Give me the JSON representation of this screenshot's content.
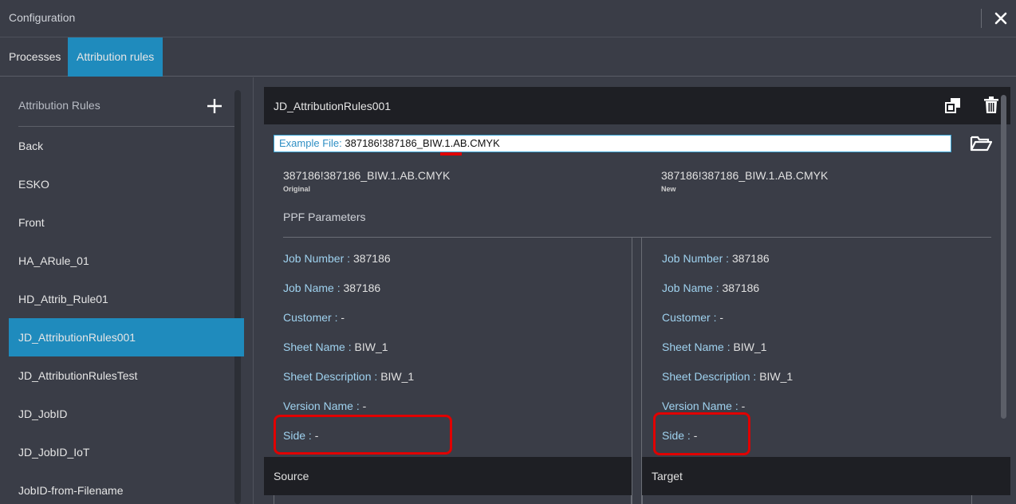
{
  "window": {
    "title": "Configuration",
    "close_icon": "close-icon"
  },
  "tabs": [
    {
      "label": "Processes",
      "active": false
    },
    {
      "label": "Attribution rules",
      "active": true
    }
  ],
  "sidebar": {
    "header": "Attribution Rules",
    "add_icon": "plus-icon",
    "items": [
      {
        "label": "Back",
        "active": false
      },
      {
        "label": "ESKO",
        "active": false
      },
      {
        "label": "Front",
        "active": false
      },
      {
        "label": "HA_ARule_01",
        "active": false
      },
      {
        "label": "HD_Attrib_Rule01",
        "active": false
      },
      {
        "label": "JD_AttributionRules001",
        "active": true
      },
      {
        "label": "JD_AttributionRulesTest",
        "active": false
      },
      {
        "label": "JD_JobID",
        "active": false
      },
      {
        "label": "JD_JobID_IoT",
        "active": false
      },
      {
        "label": "JobID-from-Filename",
        "active": false
      }
    ]
  },
  "rule": {
    "name": "JD_AttributionRules001",
    "example_label": "Example File:",
    "example_value": "387186!387186_BIW.1.AB.CMYK",
    "original_name": "387186!387186_BIW.1.AB.CMYK",
    "original_caption": "Original",
    "new_name": "387186!387186_BIW.1.AB.CMYK",
    "new_caption": "New",
    "section_title": "PPF Parameters",
    "source_params": [
      {
        "key": "Job Number",
        "value": "387186"
      },
      {
        "key": "Job Name",
        "value": "387186"
      },
      {
        "key": "Customer",
        "value": "-"
      },
      {
        "key": "Sheet Name",
        "value": "BIW_1"
      },
      {
        "key": "Sheet Description",
        "value": "BIW_1"
      },
      {
        "key": "Version Name",
        "value": "-"
      },
      {
        "key": "Side",
        "value": "-"
      }
    ],
    "target_params": [
      {
        "key": "Job Number",
        "value": "387186"
      },
      {
        "key": "Job Name",
        "value": "387186"
      },
      {
        "key": "Customer",
        "value": "-"
      },
      {
        "key": "Sheet Name",
        "value": "BIW_1"
      },
      {
        "key": "Sheet Description",
        "value": "BIW_1"
      },
      {
        "key": "Version Name",
        "value": "-"
      },
      {
        "key": "Side",
        "value": "-"
      }
    ],
    "source_label": "Source",
    "target_label": "Target"
  },
  "colors": {
    "accent": "#1f8bbd",
    "background": "#3a3d47",
    "panel_dark": "#1e1f24",
    "param_key": "#9fd2ef",
    "highlight": "#e00000"
  }
}
